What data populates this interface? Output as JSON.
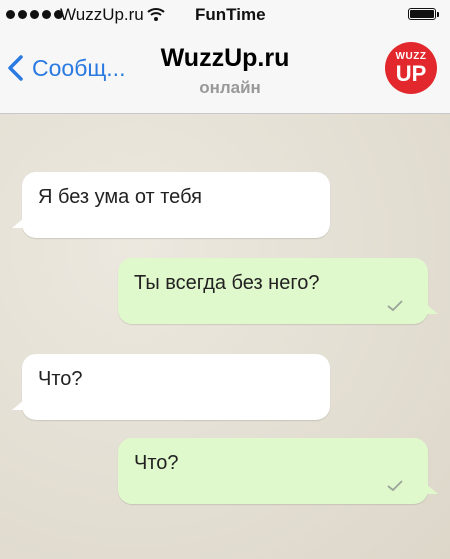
{
  "status_bar": {
    "carrier": "WuzzUp.ru",
    "time": "FunTime",
    "icons": [
      "signal-icon",
      "wifi-icon",
      "battery-icon"
    ]
  },
  "nav": {
    "back_label": "Сообщ...",
    "title": "WuzzUp.ru",
    "status": "онлайн",
    "avatar": {
      "line1": "WUZZ",
      "line2": "UP",
      "color": "#e2282c"
    },
    "accent": "#2a7ae2"
  },
  "messages": [
    {
      "direction": "incoming",
      "text": "Я без ума от тебя"
    },
    {
      "direction": "outgoing",
      "text": "Ты всегда без него?",
      "status_icon": "check-icon"
    },
    {
      "direction": "incoming",
      "text": "Что?"
    },
    {
      "direction": "outgoing",
      "text": "Что?",
      "status_icon": "check-icon"
    }
  ],
  "colors": {
    "incoming_bubble": "#ffffff",
    "outgoing_bubble": "#e0f9cc",
    "chat_background": "#e6e1d6"
  }
}
